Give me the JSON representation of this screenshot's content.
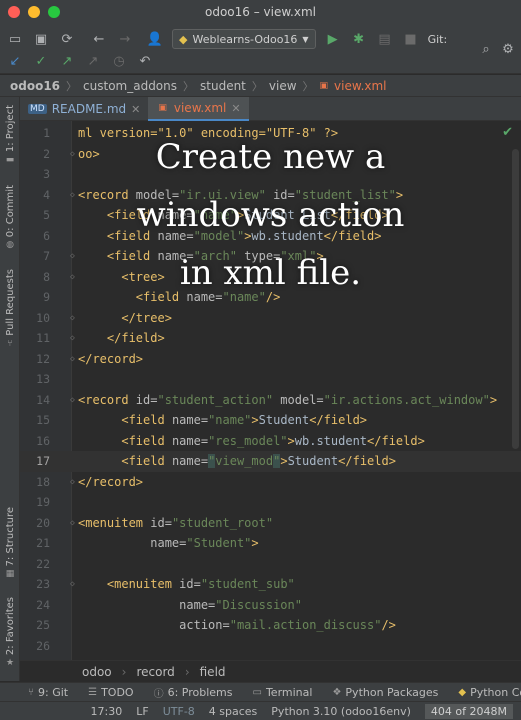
{
  "window": {
    "title": "odoo16 – view.xml"
  },
  "toolbar": {
    "run_config": "Weblearns-Odoo16",
    "git_label": "Git:"
  },
  "breadcrumb": [
    "odoo16",
    "custom_addons",
    "student",
    "view",
    "view.xml"
  ],
  "tabs": [
    {
      "label": "README.md",
      "active": false
    },
    {
      "label": "view.xml",
      "active": true
    }
  ],
  "side_tabs": {
    "project": "1: Project",
    "commit": "0: Commit",
    "pull_requests": "Pull Requests",
    "structure": "7: Structure",
    "favorites": "2: Favorites"
  },
  "code_lines": [
    {
      "n": "1",
      "segs": [
        [
          "pi",
          "ml version=\"1.0\" encoding=\"UTF-8\" ?>"
        ]
      ]
    },
    {
      "n": "2",
      "segs": [
        [
          "tg",
          "oo>"
        ]
      ]
    },
    {
      "n": "3",
      "segs": []
    },
    {
      "n": "4",
      "segs": [
        [
          "tg",
          "<record "
        ],
        [
          "at",
          "model="
        ],
        [
          "va",
          "\"ir.ui.view\""
        ],
        [
          "at",
          " id="
        ],
        [
          "va",
          "\"student_list\""
        ],
        [
          "tg",
          ">"
        ]
      ]
    },
    {
      "n": "5",
      "segs": [
        [
          "tx",
          "    "
        ],
        [
          "tg",
          "<field "
        ],
        [
          "at",
          "name="
        ],
        [
          "va",
          "\"name\""
        ],
        [
          "tg",
          ">"
        ],
        [
          "tx",
          "Student List"
        ],
        [
          "tg",
          "</field>"
        ]
      ]
    },
    {
      "n": "6",
      "segs": [
        [
          "tx",
          "    "
        ],
        [
          "tg",
          "<field "
        ],
        [
          "at",
          "name="
        ],
        [
          "va",
          "\"model\""
        ],
        [
          "tg",
          ">"
        ],
        [
          "tx",
          "wb.student"
        ],
        [
          "tg",
          "</field>"
        ]
      ]
    },
    {
      "n": "7",
      "segs": [
        [
          "tx",
          "    "
        ],
        [
          "tg",
          "<field "
        ],
        [
          "at",
          "name="
        ],
        [
          "va",
          "\"arch\""
        ],
        [
          "at",
          " type="
        ],
        [
          "va",
          "\"xml\""
        ],
        [
          "tg",
          ">"
        ]
      ]
    },
    {
      "n": "8",
      "segs": [
        [
          "tx",
          "      "
        ],
        [
          "tg",
          "<tree>"
        ]
      ]
    },
    {
      "n": "9",
      "segs": [
        [
          "tx",
          "        "
        ],
        [
          "tg",
          "<field "
        ],
        [
          "at",
          "name="
        ],
        [
          "va",
          "\"name\""
        ],
        [
          "tg",
          "/>"
        ]
      ]
    },
    {
      "n": "10",
      "segs": [
        [
          "tx",
          "      "
        ],
        [
          "tg",
          "</tree>"
        ]
      ]
    },
    {
      "n": "11",
      "segs": [
        [
          "tx",
          "    "
        ],
        [
          "tg",
          "</field>"
        ]
      ]
    },
    {
      "n": "12",
      "segs": [
        [
          "tg",
          "</record>"
        ]
      ]
    },
    {
      "n": "13",
      "segs": []
    },
    {
      "n": "14",
      "segs": [
        [
          "tg",
          "<record "
        ],
        [
          "at",
          "id="
        ],
        [
          "va",
          "\"student_action\""
        ],
        [
          "at",
          " model="
        ],
        [
          "va",
          "\"ir.actions.act_window\""
        ],
        [
          "tg",
          ">"
        ]
      ]
    },
    {
      "n": "15",
      "segs": [
        [
          "tx",
          "      "
        ],
        [
          "tg",
          "<field "
        ],
        [
          "at",
          "name="
        ],
        [
          "va",
          "\"name\""
        ],
        [
          "tg",
          ">"
        ],
        [
          "tx",
          "Student"
        ],
        [
          "tg",
          "</field>"
        ]
      ]
    },
    {
      "n": "16",
      "segs": [
        [
          "tx",
          "      "
        ],
        [
          "tg",
          "<field "
        ],
        [
          "at",
          "name="
        ],
        [
          "va",
          "\"res_model\""
        ],
        [
          "tg",
          ">"
        ],
        [
          "tx",
          "wb.student"
        ],
        [
          "tg",
          "</field>"
        ]
      ]
    },
    {
      "n": "17",
      "segs": [
        [
          "tx",
          "      "
        ],
        [
          "tg",
          "<field "
        ],
        [
          "at",
          "name="
        ],
        [
          "hl",
          "\""
        ],
        [
          "va",
          "view_mod"
        ],
        [
          "hl",
          "\""
        ],
        [
          "tg",
          ">"
        ],
        [
          "tx",
          "Student"
        ],
        [
          "tg",
          "</field>"
        ]
      ],
      "current": true
    },
    {
      "n": "18",
      "segs": [
        [
          "tg",
          "</record>"
        ]
      ]
    },
    {
      "n": "19",
      "segs": []
    },
    {
      "n": "20",
      "segs": [
        [
          "tg",
          "<menuitem "
        ],
        [
          "at",
          "id="
        ],
        [
          "va",
          "\"student_root\""
        ]
      ]
    },
    {
      "n": "21",
      "segs": [
        [
          "tx",
          "          "
        ],
        [
          "at",
          "name="
        ],
        [
          "va",
          "\"Student\""
        ],
        [
          "tg",
          ">"
        ]
      ]
    },
    {
      "n": "22",
      "segs": []
    },
    {
      "n": "23",
      "segs": [
        [
          "tx",
          "    "
        ],
        [
          "tg",
          "<menuitem "
        ],
        [
          "at",
          "id="
        ],
        [
          "va",
          "\"student_sub\""
        ]
      ]
    },
    {
      "n": "24",
      "segs": [
        [
          "tx",
          "              "
        ],
        [
          "at",
          "name="
        ],
        [
          "va",
          "\"Discussion\""
        ]
      ]
    },
    {
      "n": "25",
      "segs": [
        [
          "tx",
          "              "
        ],
        [
          "at",
          "action="
        ],
        [
          "va",
          "\"mail.action_discuss\""
        ],
        [
          "tg",
          "/>"
        ]
      ]
    },
    {
      "n": "26",
      "segs": []
    }
  ],
  "overlay": [
    "Create new a",
    "windows action",
    "in xml file."
  ],
  "editor_breadcrumb": [
    "odoo",
    "record",
    "field"
  ],
  "tool_windows": [
    {
      "label": "9: Git",
      "icon": "git-branch-icon"
    },
    {
      "label": "TODO",
      "icon": "list-icon"
    },
    {
      "label": "6: Problems",
      "icon": "info-icon"
    },
    {
      "label": "Terminal",
      "icon": "terminal-icon"
    },
    {
      "label": "Python Packages",
      "icon": "packages-icon"
    },
    {
      "label": "Python Cons",
      "icon": "python-icon"
    }
  ],
  "status": {
    "position": "17:30",
    "line_sep": "LF",
    "encoding": "UTF-8",
    "indent": "4 spaces",
    "interpreter": "Python 3.10 (odoo16env)",
    "memory": "404 of 2048M"
  }
}
